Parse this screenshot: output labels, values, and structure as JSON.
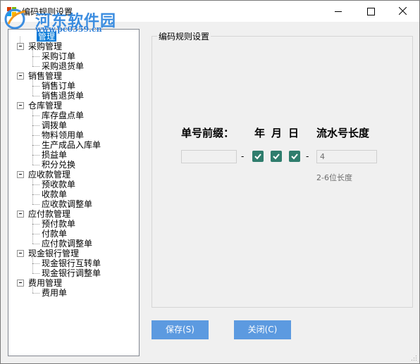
{
  "window": {
    "title": "编码规则设置"
  },
  "watermark": {
    "name": "河东软件园",
    "url": "www.pc0359.cn"
  },
  "tree": {
    "root": "管理",
    "groups": [
      {
        "label": "采购管理",
        "items": [
          "采购订单",
          "采购退货单"
        ]
      },
      {
        "label": "销售管理",
        "items": [
          "销售订单",
          "销售退货单"
        ]
      },
      {
        "label": "仓库管理",
        "items": [
          "库存盘点单",
          "调拨单",
          "物料领用单",
          "生产成品入库单",
          "损益单",
          "积分兑换"
        ]
      },
      {
        "label": "应收款管理",
        "items": [
          "预收款单",
          "收款单",
          "应收款调整单"
        ]
      },
      {
        "label": "应付款管理",
        "items": [
          "预付款单",
          "付款单",
          "应付款调整单"
        ]
      },
      {
        "label": "现金银行管理",
        "items": [
          "现金银行互转单",
          "现金银行调整单"
        ]
      },
      {
        "label": "费用管理",
        "items": [
          "费用单"
        ]
      }
    ]
  },
  "panel": {
    "title": "编码规则设置",
    "prefix_label": "单号前缀：",
    "year_label": "年",
    "month_label": "月",
    "day_label": "日",
    "serial_label": "流水号长度",
    "prefix_value": "",
    "serial_value": "4",
    "hint": "2-6位长度",
    "dash": "-",
    "checks": {
      "year": true,
      "month": true,
      "day": true
    }
  },
  "buttons": {
    "save": "保存(S)",
    "close": "关闭(C)"
  },
  "colors": {
    "selection": "#0078d7",
    "button": "#5c9ae0",
    "checkbox": "#2f7d6d"
  }
}
